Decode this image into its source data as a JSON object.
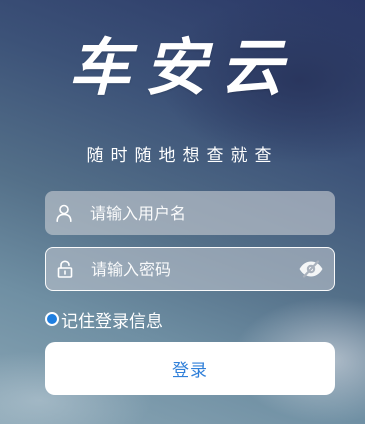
{
  "app": {
    "title": "车安云",
    "slogan": "随时随地想查就查"
  },
  "login_form": {
    "username": {
      "value": "",
      "placeholder": "请输入用户名",
      "icon": "user-icon"
    },
    "password": {
      "value": "",
      "placeholder": "请输入密码",
      "icon": "lock-icon",
      "visibility_icon": "eye-hidden-icon"
    },
    "remember_label": "记住登录信息",
    "remember_checked": true,
    "submit_label": "登录"
  },
  "colors": {
    "accent": "#2f7fd9",
    "radio_fill": "#1f7fe0",
    "field_bg": "#c8cdd4"
  }
}
